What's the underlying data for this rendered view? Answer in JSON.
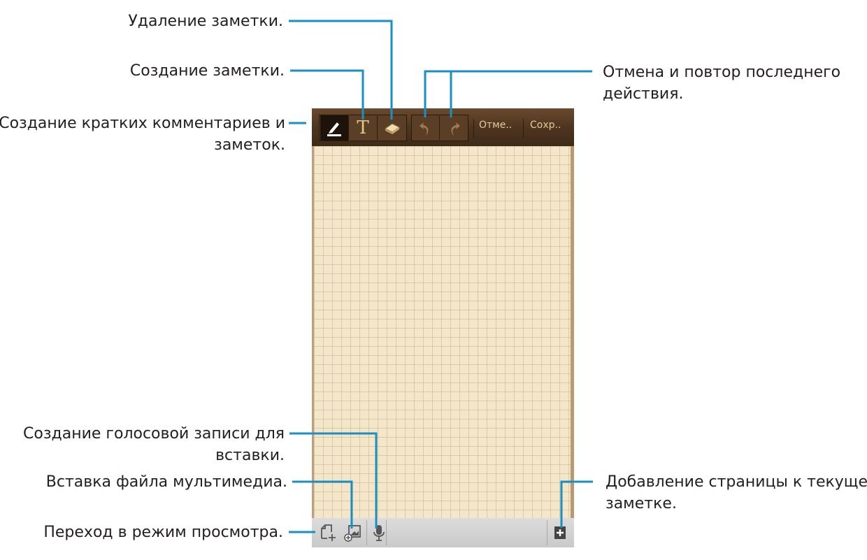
{
  "labels": {
    "delete_note": "Удаление заметки.",
    "create_note": "Создание заметки.",
    "short_comments_line1": "Создание кратких комментариев и",
    "short_comments_line2": "заметок.",
    "undo_redo_line1": "Отмена и повтор последнего",
    "undo_redo_line2": "действия.",
    "voice_line1": "Создание голосовой записи для",
    "voice_line2": "вставки.",
    "insert_media": "Вставка файла мультимедиа.",
    "view_mode": "Переход в режим просмотра.",
    "add_page_line1": "Добавление страницы к текущей",
    "add_page_line2": "заметке."
  },
  "toolbar": {
    "cancel_label": "Отме..",
    "save_label": "Сохр..",
    "icons": [
      "pen-icon",
      "text-icon",
      "eraser-icon",
      "undo-icon",
      "redo-icon"
    ]
  },
  "bottom_toolbar": {
    "icons": [
      "view-mode-icon",
      "insert-media-icon",
      "microphone-icon",
      "add-page-icon"
    ]
  },
  "colors": {
    "callout_line": "#1a8fc3",
    "toolbar_bg": "#4e3520",
    "paper_bg": "#f4e6c9",
    "frame_bg": "#d2b48c",
    "toolbar_text": "#e6ca96"
  }
}
